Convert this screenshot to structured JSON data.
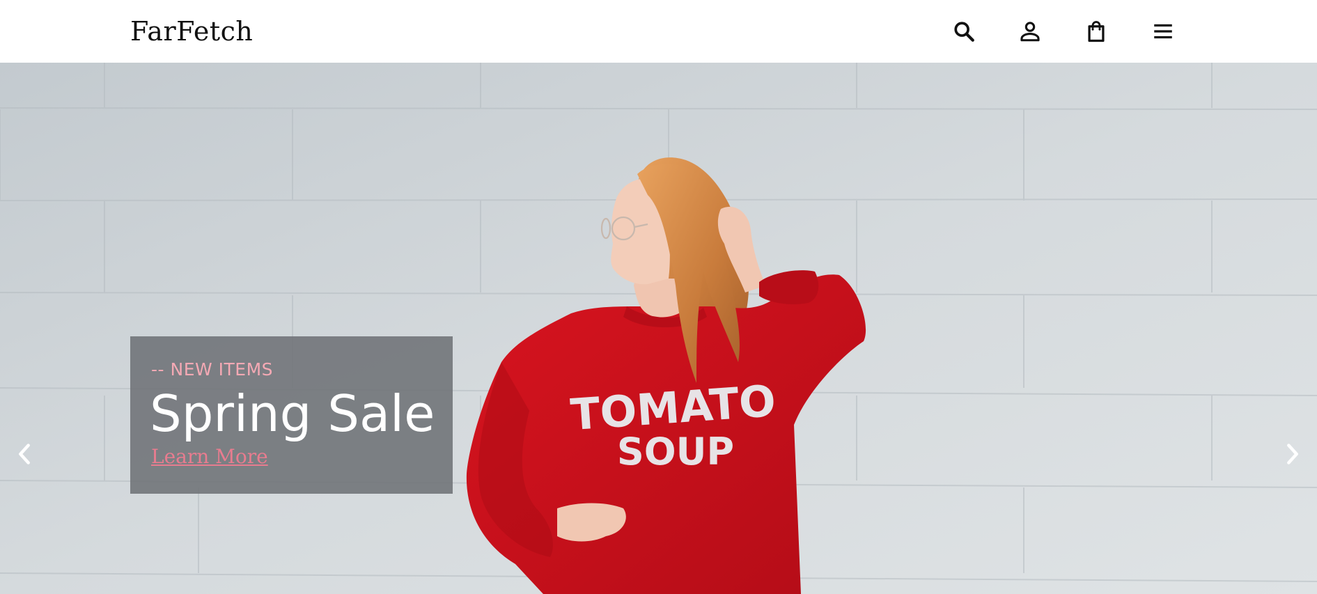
{
  "header": {
    "logo": "FarFetch",
    "icons": [
      "search-icon",
      "account-icon",
      "shopping-bag-icon",
      "menu-icon"
    ]
  },
  "hero": {
    "eyebrow": "-- NEW ITEMS",
    "headline": "Spring Sale",
    "cta_label": "Learn More",
    "sweatshirt_text_line1": "TOMATO",
    "sweatshirt_text_line2": "SOUP",
    "prev_icon": "chevron-left-icon",
    "next_icon": "chevron-right-icon"
  },
  "colors": {
    "header_bg": "#ffffff",
    "caption_bg": "#6e7276",
    "eyebrow": "#f4a9b4",
    "cta": "#e87c8f",
    "headline": "#ffffff",
    "wall": "#cdd3d7",
    "sweatshirt": "#c8101c"
  }
}
